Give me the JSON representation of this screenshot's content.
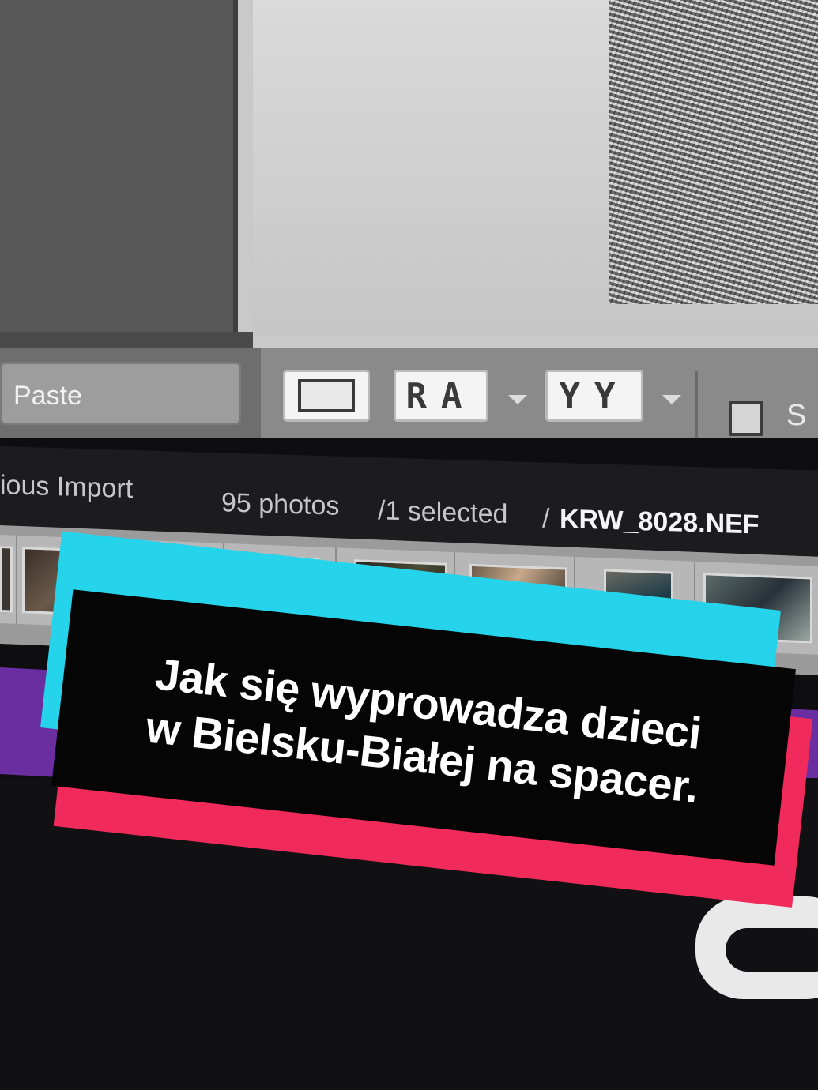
{
  "toolbar": {
    "paste_label": "Paste",
    "compare_glyph": "RA",
    "survey_glyph": "YY",
    "cut_off_label": "S"
  },
  "status": {
    "source": "ious Import",
    "photo_count": "95 photos",
    "selected": "/1 selected",
    "file_sep": "/",
    "file_name": "KRW_8028.NEF"
  },
  "filmstrip": {
    "thumbnail_count": 8
  },
  "caption": {
    "line1": "Jak się wyprowadza dzieci",
    "line2": "w Bielsku-Białej na spacer."
  },
  "colors": {
    "sticker_cyan": "#25d3ea",
    "sticker_red": "#f02a5a",
    "sticker_black": "#050505",
    "purple_band": "#6a2ea0"
  }
}
